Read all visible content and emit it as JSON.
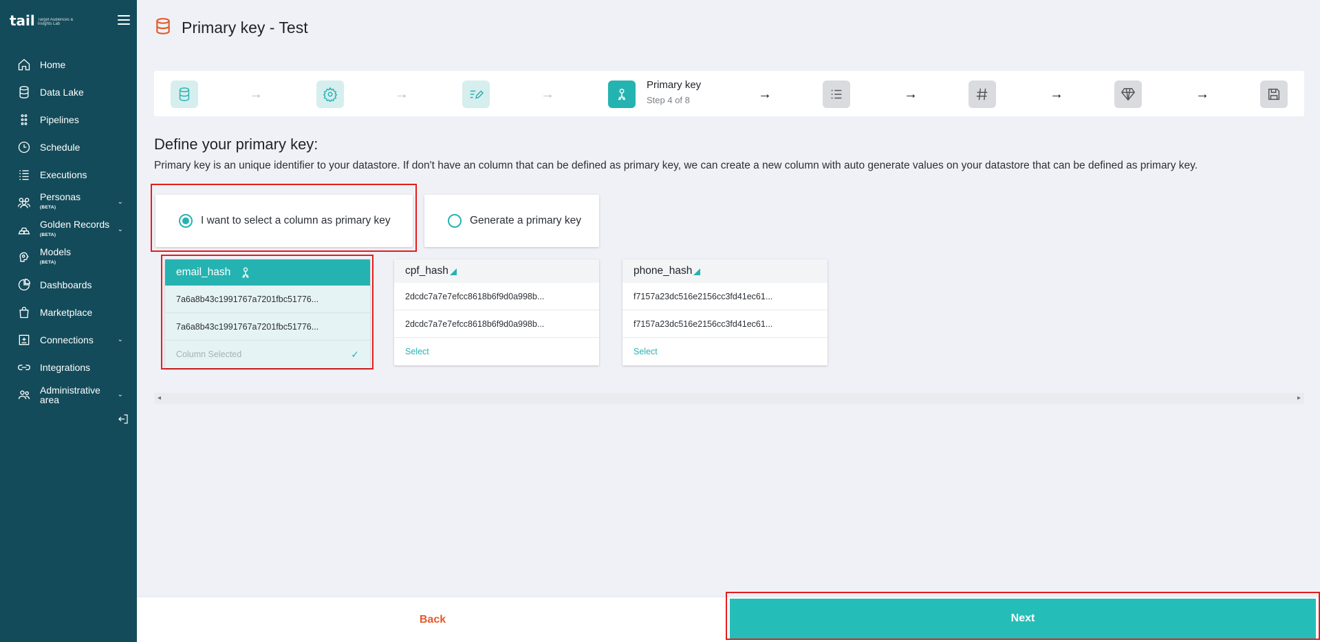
{
  "app": {
    "logo_text": "tail",
    "logo_tagline": "Target Audiences & Insights Lab"
  },
  "sidebar": {
    "items": [
      {
        "label": "Home",
        "sub": "",
        "icon": "home-icon",
        "has_chevron": false
      },
      {
        "label": "Data Lake",
        "sub": "",
        "icon": "database-icon",
        "has_chevron": false
      },
      {
        "label": "Pipelines",
        "sub": "",
        "icon": "pipeline-icon",
        "has_chevron": false
      },
      {
        "label": "Schedule",
        "sub": "",
        "icon": "clock-icon",
        "has_chevron": false
      },
      {
        "label": "Executions",
        "sub": "",
        "icon": "list-icon",
        "has_chevron": false
      },
      {
        "label": "Personas",
        "sub": "(BETA)",
        "icon": "people-icon",
        "has_chevron": true
      },
      {
        "label": "Golden Records",
        "sub": "(BETA)",
        "icon": "gold-bars-icon",
        "has_chevron": true
      },
      {
        "label": "Models",
        "sub": "(BETA)",
        "icon": "brain-icon",
        "has_chevron": false
      },
      {
        "label": "Dashboards",
        "sub": "",
        "icon": "pie-chart-icon",
        "has_chevron": false
      },
      {
        "label": "Marketplace",
        "sub": "",
        "icon": "bag-icon",
        "has_chevron": false
      },
      {
        "label": "Connections",
        "sub": "",
        "icon": "connection-icon",
        "has_chevron": true
      },
      {
        "label": "Integrations",
        "sub": "",
        "icon": "link-icon",
        "has_chevron": false
      },
      {
        "label": "Administrative area",
        "sub": "",
        "icon": "admin-icon",
        "has_chevron": true
      }
    ]
  },
  "header": {
    "title": "Primary key - Test"
  },
  "stepper": {
    "current_title": "Primary key",
    "current_sub": "Step 4 of 8",
    "steps": [
      "database-icon",
      "gear-icon",
      "edit-list-icon",
      "key-icon",
      "checklist-icon",
      "hash-icon",
      "diamond-icon",
      "save-icon"
    ]
  },
  "content": {
    "title": "Define your primary key:",
    "description": "Primary key is an unique identifier to your datastore. If don't have an column that can be defined as primary key, we can create a new column with auto generate values on your datastore that can be defined as primary key.",
    "options": [
      {
        "label": "I want to select a column as primary key",
        "selected": true
      },
      {
        "label": "Generate a primary key",
        "selected": false
      }
    ],
    "columns": [
      {
        "name": "email_hash",
        "values": [
          "7a6a8b43c1991767a7201fbc51776...",
          "7a6a8b43c1991767a7201fbc51776..."
        ],
        "footer": "Column Selected",
        "selected": true
      },
      {
        "name": "cpf_hash",
        "values": [
          "2dcdc7a7e7efcc8618b6f9d0a998b...",
          "2dcdc7a7e7efcc8618b6f9d0a998b..."
        ],
        "footer": "Select",
        "selected": false
      },
      {
        "name": "phone_hash",
        "values": [
          "f7157a23dc516e2156cc3fd41ec61...",
          "f7157a23dc516e2156cc3fd41ec61..."
        ],
        "footer": "Select",
        "selected": false
      }
    ]
  },
  "footer": {
    "back_label": "Back",
    "next_label": "Next"
  },
  "colors": {
    "teal": "#25b3b1",
    "sidebar": "#134b5a",
    "orange": "#e35a2a",
    "highlight_red": "#e41c1c"
  }
}
